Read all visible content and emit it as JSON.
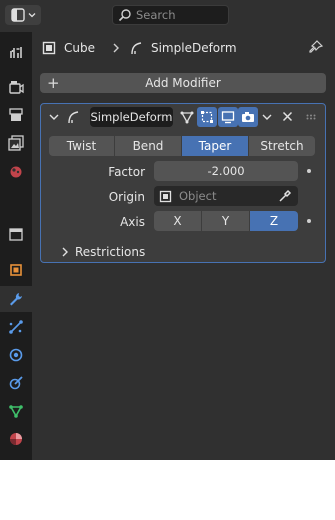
{
  "toolbar": {
    "editor_type_icon": "properties-editor-icon",
    "search_placeholder": "Search"
  },
  "tabs": [
    {
      "icon": "tool-icon"
    },
    {
      "icon": "render-icon"
    },
    {
      "icon": "output-icon"
    },
    {
      "icon": "view-layer-icon"
    },
    {
      "icon": "scene-icon"
    },
    {
      "icon": "world-icon"
    },
    {
      "icon": "object-icon"
    },
    {
      "icon": "modifier-wrench-icon",
      "active": true
    },
    {
      "icon": "particles-icon"
    },
    {
      "icon": "physics-icon"
    },
    {
      "icon": "constraints-icon"
    },
    {
      "icon": "object-data-icon"
    },
    {
      "icon": "material-icon"
    }
  ],
  "breadcrumb": {
    "object": "Cube",
    "modifier": "SimpleDeform"
  },
  "add_modifier": {
    "label": "Add Modifier"
  },
  "modifier": {
    "name": "SimpleDeform",
    "modes": [
      "Twist",
      "Bend",
      "Taper",
      "Stretch"
    ],
    "active_mode": "Taper",
    "factor_label": "Factor",
    "factor_value": "-2.000",
    "origin_label": "Origin",
    "origin_placeholder": "Object",
    "axis_label": "Axis",
    "axes": [
      "X",
      "Y",
      "Z"
    ],
    "active_axis": "Z",
    "restrictions_label": "Restrictions"
  },
  "colors": {
    "accent": "#4772b3",
    "panel": "#303030",
    "sidebar": "#1d1d1d",
    "button": "#545454"
  }
}
